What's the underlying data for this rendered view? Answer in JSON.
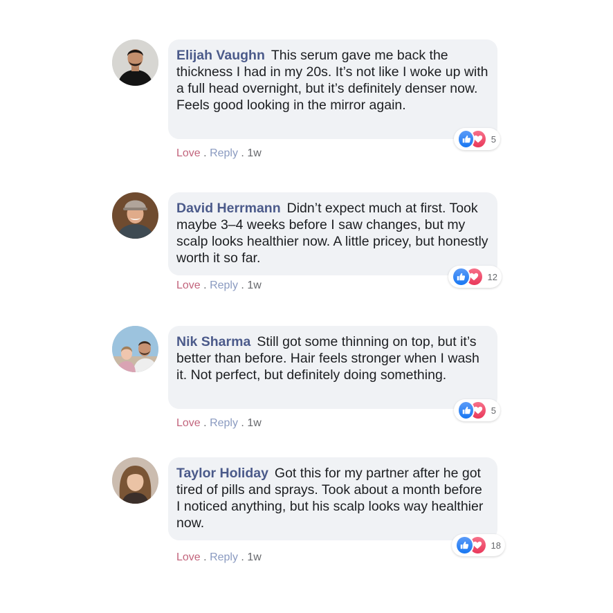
{
  "comments": [
    {
      "author": "Elijah Vaughn",
      "text": "This serum gave me back the thickness I had in my 20s. It’s not like I woke up with a full head overnight, but it’s definitely denser now. Feels good looking in the mirror again.",
      "reaction_count": "5",
      "love_label": "Love",
      "reply_label": "Reply",
      "time": "1w",
      "avatar": "avatar-elijah"
    },
    {
      "author": "David Herrmann",
      "text": "Didn’t expect much at first. Took maybe 3–4 weeks before I saw changes, but my scalp looks healthier now. A little pricey, but honestly worth it so far.",
      "reaction_count": "12",
      "love_label": "Love",
      "reply_label": "Reply",
      "time": "1w",
      "avatar": "avatar-david"
    },
    {
      "author": "Nik Sharma",
      "text": "Still got some thinning on top, but it’s better than before. Hair feels stronger when I wash it. Not perfect, but definitely doing something.",
      "reaction_count": "5",
      "love_label": "Love",
      "reply_label": "Reply",
      "time": "1w",
      "avatar": "avatar-nik"
    },
    {
      "author": "Taylor Holiday",
      "text": "Got this for my partner after he got tired of pills and sprays. Took about a month before I noticed anything, but his scalp looks way healthier now.",
      "reaction_count": "18",
      "love_label": "Love",
      "reply_label": "Reply",
      "time": "1w",
      "avatar": "avatar-taylor"
    }
  ],
  "separator": ".",
  "icons": {
    "like": "thumbs-up-icon",
    "love": "heart-icon"
  },
  "colors": {
    "author": "#4b5a8a",
    "love": "#c2647c",
    "reply": "#8a9ac0",
    "bubble": "#f0f2f5",
    "like": "#1877f2",
    "heart": "#e9385a"
  }
}
